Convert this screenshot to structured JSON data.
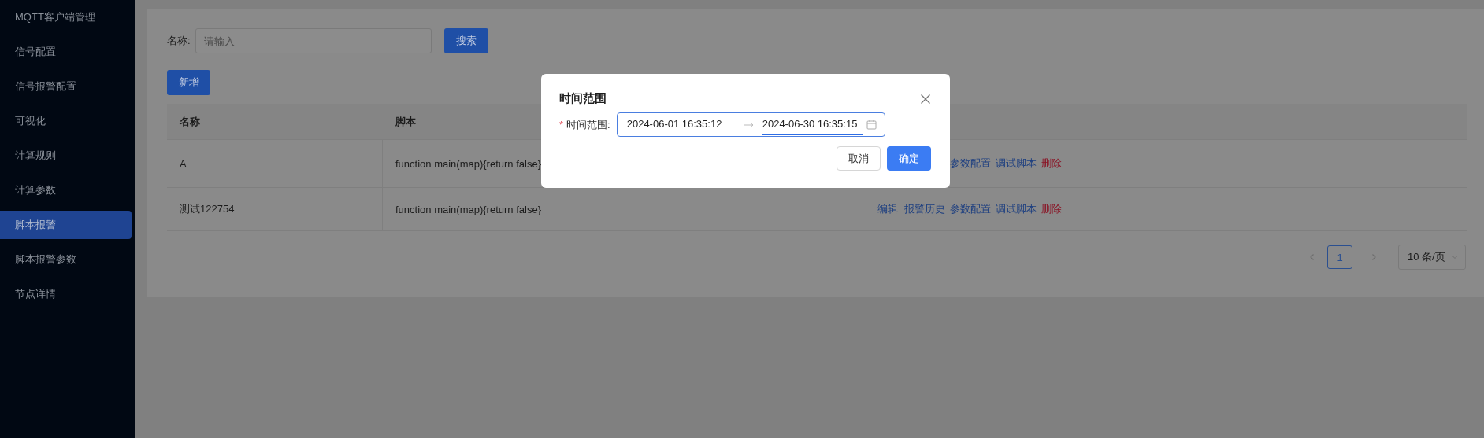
{
  "sidebar": {
    "items": [
      {
        "label": "MQTT客户端管理",
        "selected": false
      },
      {
        "label": "信号配置",
        "selected": false
      },
      {
        "label": "信号报警配置",
        "selected": false
      },
      {
        "label": "可视化",
        "selected": false
      },
      {
        "label": "计算规则",
        "selected": false
      },
      {
        "label": "计算参数",
        "selected": false
      },
      {
        "label": "脚本报警",
        "selected": true
      },
      {
        "label": "脚本报警参数",
        "selected": false
      },
      {
        "label": "节点详情",
        "selected": false
      }
    ]
  },
  "search": {
    "label": "名称:",
    "placeholder": "请输入",
    "button": "搜索"
  },
  "add_button": "新增",
  "table": {
    "columns": [
      "名称",
      "脚本"
    ],
    "rows": [
      {
        "name": "A",
        "script": "function main(map){return false}",
        "actions": [
          {
            "kind": "params",
            "label": "参数配置"
          },
          {
            "kind": "debug",
            "label": "调试脚本"
          },
          {
            "kind": "delete",
            "label": "删除"
          }
        ]
      },
      {
        "name": "测试122754",
        "script": "function main(map){return false}",
        "actions": [
          {
            "kind": "edit",
            "label": "编辑"
          },
          {
            "kind": "history",
            "label": "报警历史"
          },
          {
            "kind": "params",
            "label": "参数配置"
          },
          {
            "kind": "debug",
            "label": "调试脚本"
          },
          {
            "kind": "delete",
            "label": "删除"
          }
        ]
      }
    ]
  },
  "pagination": {
    "pages": [
      {
        "label": "1",
        "selected": true
      }
    ],
    "page_size": "10 条/页"
  },
  "dialog": {
    "title": "时间范围",
    "field": {
      "label": "时间范围:",
      "required_mark": "*",
      "dates": [
        {
          "value": "2024-06-01 16:35:12",
          "selected": false
        },
        {
          "value": "2024-06-30 16:35:15",
          "selected": true
        }
      ]
    },
    "buttons": [
      {
        "label": "取消",
        "kind": "default"
      },
      {
        "label": "确定",
        "kind": "primary"
      }
    ]
  }
}
